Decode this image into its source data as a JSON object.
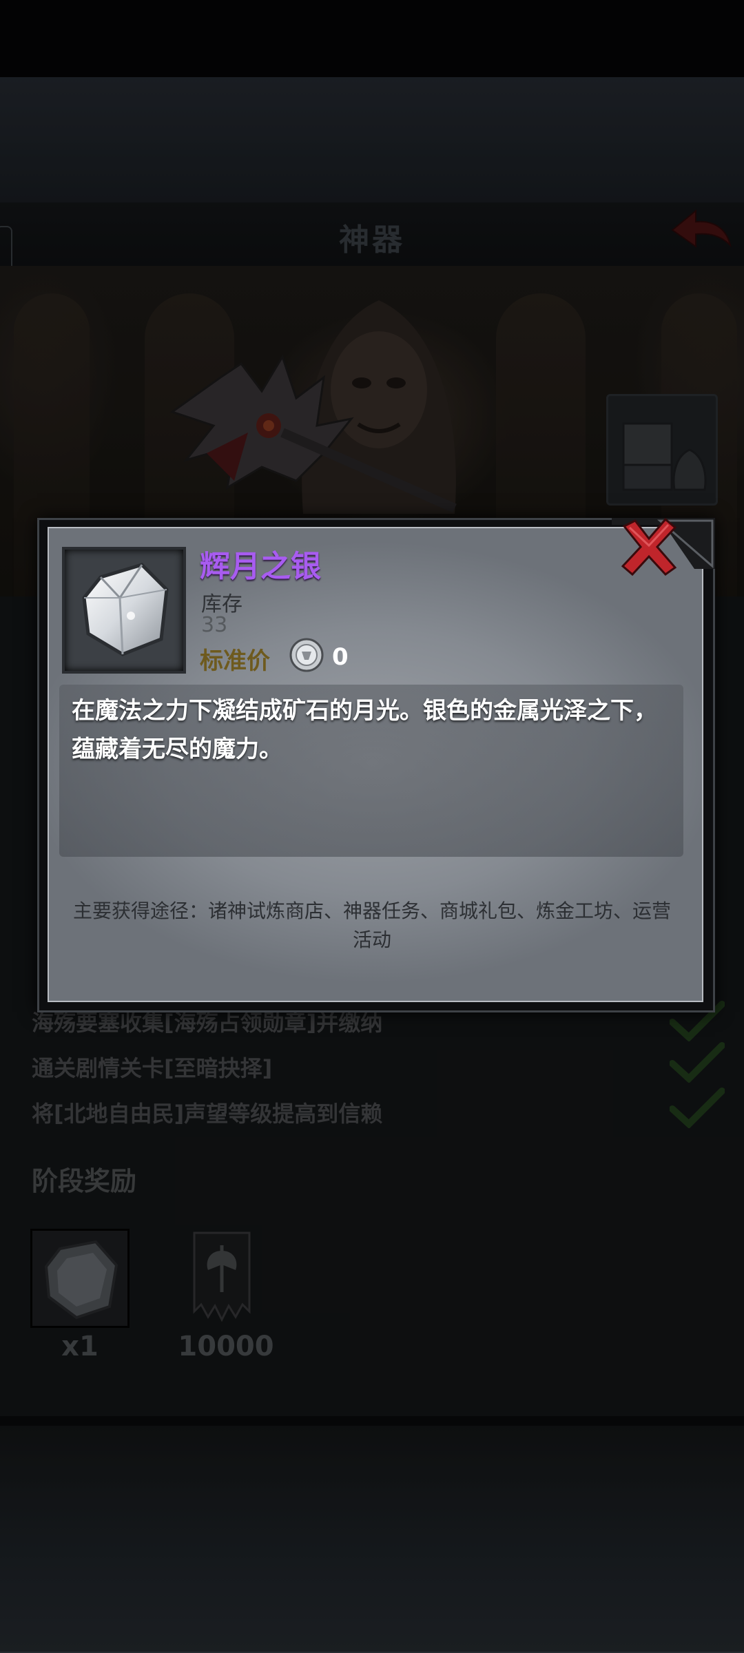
{
  "header": {
    "title": "神器"
  },
  "tasks": [
    {
      "label": "海殇要塞收集[海殇占领勋章]并缴纳",
      "done": true
    },
    {
      "label": "通关剧情关卡[至暗抉择]",
      "done": true
    },
    {
      "label": "将[北地自由民]声望等级提高到信赖",
      "done": true
    }
  ],
  "stage_rewards": {
    "title": "阶段奖励",
    "items": [
      {
        "icon": "moon-silver-ore-icon",
        "qty": "x1"
      },
      {
        "icon": "banner-axe-icon",
        "qty": "10000"
      }
    ]
  },
  "modal": {
    "item_name": "辉月之银",
    "stock_label": "库存",
    "stock_value": "33",
    "price_label": "标准价",
    "price_value": "0",
    "description": "在魔法之力下凝结成矿石的月光。银色的金属光泽之下，蕴藏着无尽的魔力。",
    "source": "主要获得途径：诸神试炼商店、神器任务、商城礼包、炼金工坊、运营活动",
    "colors": {
      "item_name": "#a85cf0",
      "price_label": "#6e5a1e",
      "close": "#c0252b"
    }
  }
}
